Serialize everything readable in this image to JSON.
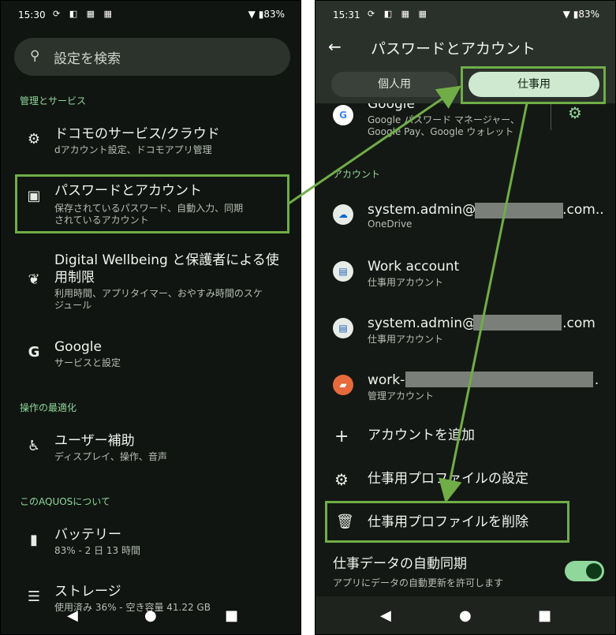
{
  "left": {
    "status": {
      "time": "15:30",
      "icons": "⟳ ◧ ▦ ▦",
      "battery": "83%"
    },
    "search": {
      "placeholder": "設定を検索"
    },
    "sections": {
      "manage": "管理とサービス",
      "optimize": "操作の最適化",
      "about": "このAQUOSについて"
    },
    "items": [
      {
        "title": "ドコモのサービス/クラウド",
        "sub": "dアカウント設定、ドコモアプリ管理",
        "icon": "gear-icon"
      },
      {
        "title": "パスワードとアカウント",
        "sub": "保存されているパスワード、自動入力、同期されているアカウント",
        "icon": "account-box-icon"
      },
      {
        "title": "Digital Wellbeing と保護者による使用制限",
        "sub": "利用時間、アプリタイマー、おやすみ時間のスケジュール",
        "icon": "wellbeing-icon"
      },
      {
        "title": "Google",
        "sub": "サービスと設定",
        "icon": "google-icon"
      },
      {
        "title": "ユーザー補助",
        "sub": "ディスプレイ、操作、音声",
        "icon": "accessibility-icon"
      },
      {
        "title": "バッテリー",
        "sub": "83% - 2 日 13 時間",
        "icon": "battery-icon"
      },
      {
        "title": "ストレージ",
        "sub": "使用済み 36% - 空き容量 41.22 GB",
        "icon": "storage-icon"
      }
    ]
  },
  "right": {
    "status": {
      "time": "15:31",
      "icons": "⟳ ◧ ▦ ▦",
      "battery": "83%"
    },
    "title": "パスワードとアカウント",
    "tabs": {
      "personal": "個人用",
      "work": "仕事用"
    },
    "google": {
      "title": "Google",
      "sub1": "Google パスワード マネージャー、",
      "sub2": "Google Pay、Google ウォレット"
    },
    "account_section": "アカウント",
    "accounts": [
      {
        "title_a": "system.admin@",
        "title_b": ".com..",
        "sub": "OneDrive"
      },
      {
        "title_a": "Work account",
        "title_b": "",
        "sub": "仕事用アカウント"
      },
      {
        "title_a": "system.admin@",
        "title_b": ".com",
        "sub": "仕事用アカウント"
      },
      {
        "title_a": "work-(",
        "title_b": ".",
        "sub": "管理アカウント"
      }
    ],
    "add_account": "アカウントを追加",
    "work_profile_settings": "仕事用プロファイルの設定",
    "delete_work_profile": "仕事用プロファイルを削除",
    "auto_sync": {
      "title": "仕事データの自動同期",
      "sub": "アプリにデータの自動更新を許可します"
    }
  },
  "colors": {
    "highlight": "#70ad47",
    "accent": "#8fd79b"
  }
}
